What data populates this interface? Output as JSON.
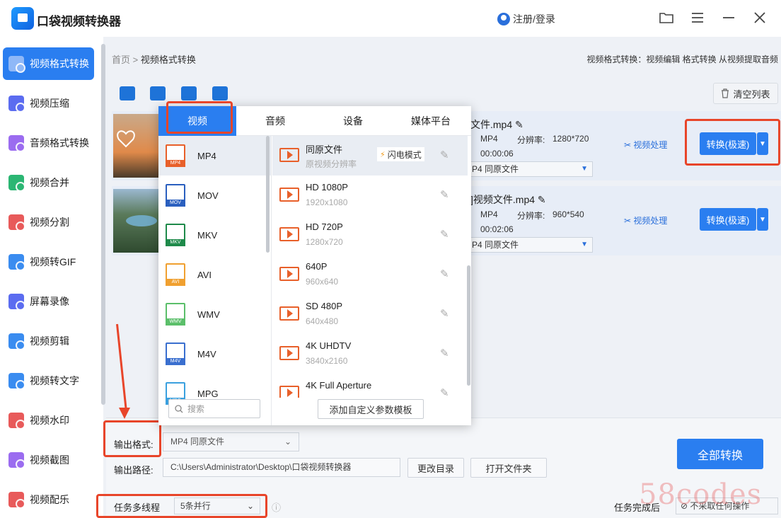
{
  "app": {
    "title": "口袋视频转换器",
    "login": "注册/登录"
  },
  "sidebar": {
    "items": [
      {
        "label": "视频格式转换",
        "color": "#ffffff"
      },
      {
        "label": "视频压缩",
        "color": "#5b6cf0"
      },
      {
        "label": "音频格式转换",
        "color": "#9b6cf0"
      },
      {
        "label": "视频合并",
        "color": "#2bb673"
      },
      {
        "label": "视频分割",
        "color": "#e85a5a"
      },
      {
        "label": "视频转GIF",
        "color": "#3a8cf0"
      },
      {
        "label": "屏幕录像",
        "color": "#5b6cf0"
      },
      {
        "label": "视频剪辑",
        "color": "#3a8cf0"
      },
      {
        "label": "视频转文字",
        "color": "#3a8cf0"
      },
      {
        "label": "视频水印",
        "color": "#e85a5a"
      },
      {
        "label": "视频截图",
        "color": "#9b6cf0"
      },
      {
        "label": "视频配乐",
        "color": "#e85a5a"
      }
    ]
  },
  "breadcrumb": {
    "home": "首页",
    "separator": ">",
    "current": "视频格式转换"
  },
  "hint": "视频格式转换：视频编辑 格式转换 从视频提取音频",
  "toolbar": {
    "clear_label": "清空列表"
  },
  "files": [
    {
      "name": "文件.mp4",
      "format": "MP4",
      "resolution_label": "分辨率:",
      "resolution": "1280*720",
      "duration": "00:00:06",
      "output": "P4  同原文件",
      "process": "视频处理",
      "convert": "转换(极速)"
    },
    {
      "name": "]视频文件.mp4",
      "format": "MP4",
      "resolution_label": "分辨率:",
      "resolution": "960*540",
      "duration": "00:02:06",
      "output": "P4  同原文件",
      "process": "视频处理",
      "convert": "转换(极速)"
    }
  ],
  "popup": {
    "tabs": [
      "视频",
      "音频",
      "设备",
      "媒体平台"
    ],
    "formats": [
      {
        "label": "MP4",
        "color": "#e8602a"
      },
      {
        "label": "MOV",
        "color": "#2a5fbf"
      },
      {
        "label": "MKV",
        "color": "#1e8a4a"
      },
      {
        "label": "AVI",
        "color": "#f0a030"
      },
      {
        "label": "WMV",
        "color": "#5bbf6a"
      },
      {
        "label": "M4V",
        "color": "#3a6fcf"
      },
      {
        "label": "MPG",
        "color": "#3aa0df"
      }
    ],
    "resolutions": [
      {
        "name": "同原文件",
        "sub": "原视频分辨率",
        "badge": "闪电模式"
      },
      {
        "name": "HD 1080P",
        "sub": "1920x1080"
      },
      {
        "name": "HD 720P",
        "sub": "1280x720"
      },
      {
        "name": "640P",
        "sub": "960x640"
      },
      {
        "name": "SD 480P",
        "sub": "640x480"
      },
      {
        "name": "4K UHDTV",
        "sub": "3840x2160"
      },
      {
        "name": "4K Full Aperture",
        "sub": ""
      }
    ],
    "search_placeholder": "搜索",
    "add_template": "添加自定义参数模板"
  },
  "bottom": {
    "output_format_label": "输出格式:",
    "output_format_value": "MP4  同原文件",
    "output_path_label": "输出路径:",
    "output_path_value": "C:\\Users\\Administrator\\Desktop\\口袋视频转换器",
    "change_dir": "更改目录",
    "open_folder": "打开文件夹",
    "convert_all": "全部转换",
    "threads_label": "任务多线程",
    "threads_value": "5条并行",
    "after_label": "任务完成后",
    "after_value": "不采取任何操作"
  },
  "watermark": "58codes"
}
